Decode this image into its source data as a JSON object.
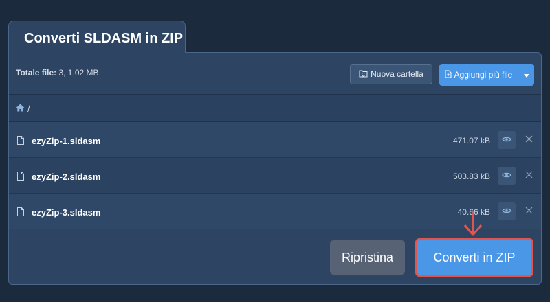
{
  "tab": {
    "title": "Converti SLDASM in ZIP"
  },
  "toolbar": {
    "total_label": "Totale file:",
    "total_value": "3, 1.02 MB",
    "new_folder_label": "Nuova cartella",
    "add_files_label": "Aggiungi più file"
  },
  "breadcrumb": {
    "path": "/"
  },
  "files": [
    {
      "name": "ezyZip-1.sldasm",
      "size": "471.07 kB"
    },
    {
      "name": "ezyZip-2.sldasm",
      "size": "503.83 kB"
    },
    {
      "name": "ezyZip-3.sldasm",
      "size": "40.66 kB"
    }
  ],
  "actions": {
    "reset_label": "Ripristina",
    "convert_label": "Converti in ZIP"
  },
  "colors": {
    "background": "#1b2a3c",
    "panel": "#2d4563",
    "accent": "#4a97e8",
    "highlight": "#e0564e",
    "reset": "#576274"
  },
  "icons": [
    "folder-sync-icon",
    "file-plus-icon",
    "chevron-down-icon",
    "home-icon",
    "file-icon",
    "eye-icon",
    "close-icon",
    "arrow-down-icon"
  ]
}
